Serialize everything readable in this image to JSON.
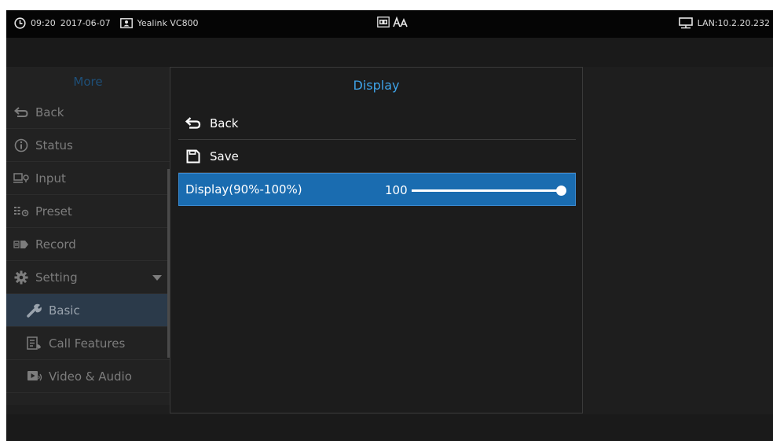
{
  "statusbar": {
    "time": "09:20",
    "date": "2017-06-07",
    "device": "Yealink VC800",
    "network": "LAN:10.2.20.232",
    "icons": [
      "clock-icon",
      "contact-card-icon",
      "vcr-icon",
      "font-size-icon",
      "network-icon"
    ]
  },
  "sidebar": {
    "title": "More",
    "items": [
      {
        "label": "Back",
        "icon": "back-arrow-icon"
      },
      {
        "label": "Status",
        "icon": "info-icon"
      },
      {
        "label": "Input",
        "icon": "input-icon"
      },
      {
        "label": "Preset",
        "icon": "preset-icon"
      },
      {
        "label": "Record",
        "icon": "record-icon"
      },
      {
        "label": "Setting",
        "icon": "gear-icon",
        "expanded": true
      },
      {
        "label": "Basic",
        "icon": "wrench-icon",
        "active": true
      },
      {
        "label": "Call Features",
        "icon": "call-features-icon"
      },
      {
        "label": "Video & Audio",
        "icon": "video-audio-icon"
      }
    ]
  },
  "panel": {
    "title": "Display",
    "back_label": "Back",
    "save_label": "Save",
    "display_setting": {
      "label": "Display(90%-100%)",
      "value": "100",
      "min": 90,
      "max": 100,
      "current": 100
    }
  },
  "colors": {
    "accent": "#3ea3e8",
    "selected_row": "#1a6cb0",
    "screen_bg": "#1e1e1e"
  }
}
